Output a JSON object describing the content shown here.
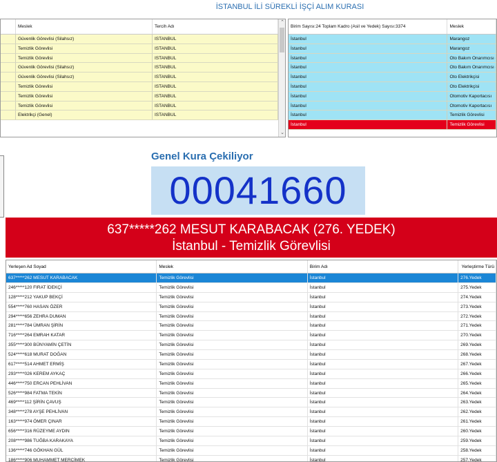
{
  "app_title": "İSTANBUL İLİ SÜREKLİ İŞÇİ ALIM KURASI",
  "left_grid": {
    "headers": [
      "",
      "Meslek",
      "Tercih Adı"
    ],
    "rows": [
      [
        "",
        "Güvenlik Görevlisi (Silahsız)",
        "ISTANBUL"
      ],
      [
        "",
        "Temizlik Görevlisi",
        "ISTANBUL"
      ],
      [
        "",
        "Temizlik Görevlisi",
        "ISTANBUL"
      ],
      [
        "",
        "Güvenlik Görevlisi (Silahsız)",
        "ISTANBUL"
      ],
      [
        "",
        "Güvenlik Görevlisi (Silahsız)",
        "ISTANBUL"
      ],
      [
        "",
        "Temizlik Görevlisi",
        "ISTANBUL"
      ],
      [
        "",
        "Temizlik Görevlisi",
        "ISTANBUL"
      ],
      [
        "",
        "Temizlik Görevlisi",
        "ISTANBUL"
      ],
      [
        "",
        "Elektrikçi (Genel)",
        "ISTANBUL"
      ]
    ]
  },
  "right_grid": {
    "headers": [
      "Birim Sayısı:24 Toplam Kadro (Asil ve Yedek) Sayısı:3374",
      "Meslek"
    ],
    "rows": [
      [
        "İstanbul",
        "Marangoz"
      ],
      [
        "İstanbul",
        "Marangoz"
      ],
      [
        "İstanbul",
        "Oto Bakım Onarımcısı (Ge"
      ],
      [
        "İstanbul",
        "Oto Bakım Onarımcısı (Ge"
      ],
      [
        "İstanbul",
        "Oto Elektrikçisi"
      ],
      [
        "İstanbul",
        "Oto Elektrikçisi"
      ],
      [
        "İstanbul",
        "Otomotiv Kaportacısı"
      ],
      [
        "İstanbul",
        "Otomotiv Kaportacısı"
      ],
      [
        "İstanbul",
        "Temizlik Görevlisi"
      ],
      [
        "İstanbul",
        "Temizlik Görevlisi"
      ]
    ],
    "selected_index": 9
  },
  "draw": {
    "label": "Genel Kura Çekiliyor",
    "number": "00041660"
  },
  "winner": {
    "line1": "637*****262 MESUT KARABACAK (276. YEDEK)",
    "line2": "İstanbul - Temizlik Görevlisi"
  },
  "bottom_grid": {
    "headers": [
      "Yerleşen Ad Soyad",
      "Meslek",
      "Birim Adı",
      "Yerleştirme Türü"
    ],
    "rows": [
      [
        "637*****262 MESUT KARABACAK",
        "Temizlik Görevlisi",
        "İstanbul",
        "276.Yedek"
      ],
      [
        "246*****120 FIRAT İDEKÇİ",
        "Temizlik Görevlisi",
        "İstanbul",
        "275.Yedek"
      ],
      [
        "128*****212 YAKUP BEKÇİ",
        "Temizlik Görevlisi",
        "İstanbul",
        "274.Yedek"
      ],
      [
        "554*****760 HASAN ÖZER",
        "Temizlik Görevlisi",
        "İstanbul",
        "273.Yedek"
      ],
      [
        "294*****656 ZEHRA DUMAN",
        "Temizlik Görevlisi",
        "İstanbul",
        "272.Yedek"
      ],
      [
        "281*****784 ÜMRAN ŞİRİN",
        "Temizlik Görevlisi",
        "İstanbul",
        "271.Yedek"
      ],
      [
        "716*****264 EMRAH KATAR",
        "Temizlik Görevlisi",
        "İstanbul",
        "270.Yedek"
      ],
      [
        "355*****300 BÜNYAMİN ÇETİN",
        "Temizlik Görevlisi",
        "İstanbul",
        "269.Yedek"
      ],
      [
        "524*****618 MURAT DOĞAN",
        "Temizlik Görevlisi",
        "İstanbul",
        "268.Yedek"
      ],
      [
        "617*****514 AHMET ERMİŞ",
        "Temizlik Görevlisi",
        "İstanbul",
        "267.Yedek"
      ],
      [
        "293*****026 KEREM AYKAÇ",
        "Temizlik Görevlisi",
        "İstanbul",
        "266.Yedek"
      ],
      [
        "446*****750 ERCAN PEHLİVAN",
        "Temizlik Görevlisi",
        "İstanbul",
        "265.Yedek"
      ],
      [
        "526*****984 FATMA TEKİN",
        "Temizlik Görevlisi",
        "İstanbul",
        "264.Yedek"
      ],
      [
        "469*****112 ŞİRİN ÇAVUŞ",
        "Temizlik Görevlisi",
        "İstanbul",
        "263.Yedek"
      ],
      [
        "348*****278 AYŞE PEHLİVAN",
        "Temizlik Görevlisi",
        "İstanbul",
        "262.Yedek"
      ],
      [
        "163*****974 ÖMER ÇINAR",
        "Temizlik Görevlisi",
        "İstanbul",
        "261.Yedek"
      ],
      [
        "656*****316 RÜZEYME AYDIN",
        "Temizlik Görevlisi",
        "İstanbul",
        "260.Yedek"
      ],
      [
        "208*****986 TUĞBA KARAKAYA",
        "Temizlik Görevlisi",
        "İstanbul",
        "259.Yedek"
      ],
      [
        "136*****746 GÖKHAN GÜL",
        "Temizlik Görevlisi",
        "İstanbul",
        "258.Yedek"
      ],
      [
        "186*****906 MUHAMMET MERCİMEK",
        "Temizlik Görevlisi",
        "İstanbul",
        "257.Yedek"
      ]
    ],
    "selected_index": 0
  },
  "colors": {
    "title_blue": "#2a6eb0",
    "left_row_bg": "#fbfac8",
    "right_row_bg": "#9fe3f5",
    "selected_red": "#e4001b",
    "banner_red": "#d40019",
    "number_box_bg": "#c6dff3",
    "number_blue": "#1432c8",
    "selected_blue": "#1b86d6"
  },
  "icons": {
    "scroll_up": "chevron-up-icon",
    "scroll_down": "chevron-down-icon"
  }
}
